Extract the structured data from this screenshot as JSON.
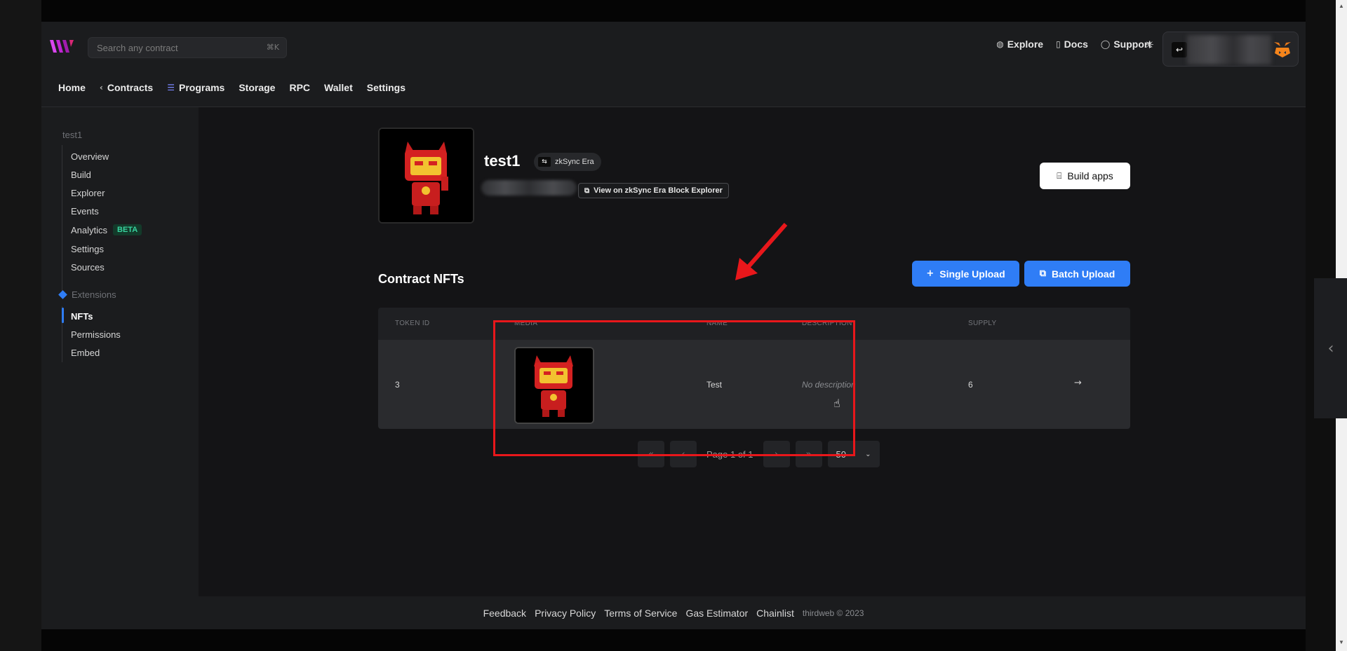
{
  "header": {
    "search_placeholder": "Search any contract",
    "search_shortcut": "⌘K",
    "links": [
      {
        "label": "Explore",
        "icon": "globe-icon"
      },
      {
        "label": "Docs",
        "icon": "document-icon"
      },
      {
        "label": "Support",
        "icon": "help-circle-icon"
      }
    ]
  },
  "nav": {
    "items": [
      {
        "label": "Home"
      },
      {
        "label": "Contracts",
        "icon": "chevron-left-icon"
      },
      {
        "label": "Programs",
        "icon": "list-icon"
      },
      {
        "label": "Storage"
      },
      {
        "label": "RPC"
      },
      {
        "label": "Wallet"
      },
      {
        "label": "Settings"
      }
    ]
  },
  "sidebar": {
    "title": "test1",
    "items": [
      {
        "label": "Overview"
      },
      {
        "label": "Build"
      },
      {
        "label": "Explorer"
      },
      {
        "label": "Events"
      },
      {
        "label": "Analytics",
        "badge": "BETA"
      },
      {
        "label": "Settings"
      },
      {
        "label": "Sources"
      }
    ],
    "extensions_label": "Extensions",
    "extension_items": [
      {
        "label": "NFTs",
        "active": true
      },
      {
        "label": "Permissions"
      },
      {
        "label": "Embed"
      }
    ]
  },
  "contract": {
    "name": "test1",
    "chain": "zkSync Era",
    "explorer_link": "View on zkSync Era Block Explorer",
    "build_label": "Build apps"
  },
  "nfts": {
    "title": "Contract NFTs",
    "single_upload": "Single Upload",
    "batch_upload": "Batch Upload",
    "columns": [
      "TOKEN ID",
      "MEDIA",
      "NAME",
      "DESCRIPTION",
      "SUPPLY"
    ],
    "rows": [
      {
        "token_id": "3",
        "name": "Test",
        "description": "No description",
        "supply": "6"
      }
    ],
    "pagination": {
      "page_text": "Page 1 of 1",
      "per_page": "50"
    }
  },
  "footer": {
    "links": [
      "Feedback",
      "Privacy Policy",
      "Terms of Service",
      "Gas Estimator",
      "Chainlist"
    ],
    "copyright": "thirdweb © 2023"
  },
  "colors": {
    "accent_blue": "#2f7df6",
    "annotation_red": "#e8171b",
    "beta_green": "#38d39f",
    "background": "#141416"
  }
}
